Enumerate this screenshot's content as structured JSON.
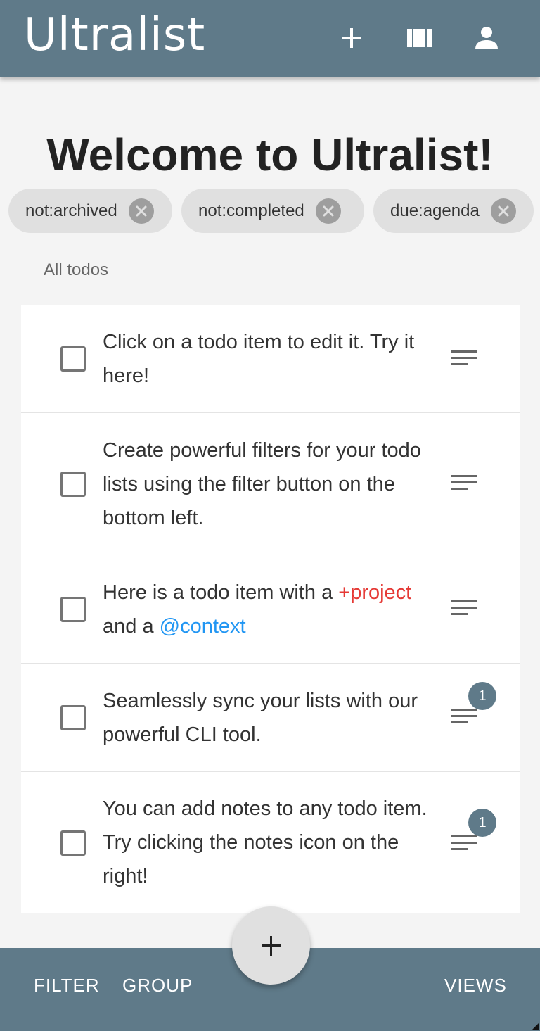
{
  "app": {
    "brand": "Ultralist",
    "icons": {
      "add": "plus-icon",
      "board": "board-view-icon",
      "account": "account-icon"
    }
  },
  "page": {
    "title": "Welcome to Ultralist!"
  },
  "filters": [
    {
      "label": "not:archived"
    },
    {
      "label": "not:completed"
    },
    {
      "label": "due:agenda"
    }
  ],
  "group": {
    "label": "All todos"
  },
  "todos": [
    {
      "text": "Click on a todo item to edit it. Try it here!",
      "notes": null
    },
    {
      "text": "Create powerful filters for your todo lists using the filter button on the bottom left.",
      "notes": null
    },
    {
      "text_before": "Here is a todo item with a",
      "project": "+project",
      "text_middle": "and a",
      "context": "@context",
      "notes": null
    },
    {
      "text": "Seamlessly sync your lists with our powerful CLI tool.",
      "notes": "1"
    },
    {
      "text": "You can add notes to any todo item. Try clicking the notes icon on the right!",
      "notes": "1"
    }
  ],
  "bottom_bar": {
    "filter_label": "FILTER",
    "group_label": "GROUP",
    "views_label": "VIEWS",
    "fab_icon": "plus-icon"
  },
  "colors": {
    "primary": "#5f7a89",
    "background": "#f4f4f4",
    "project": "#e53935",
    "context": "#2196f3",
    "chip": "#e0e0e0"
  }
}
